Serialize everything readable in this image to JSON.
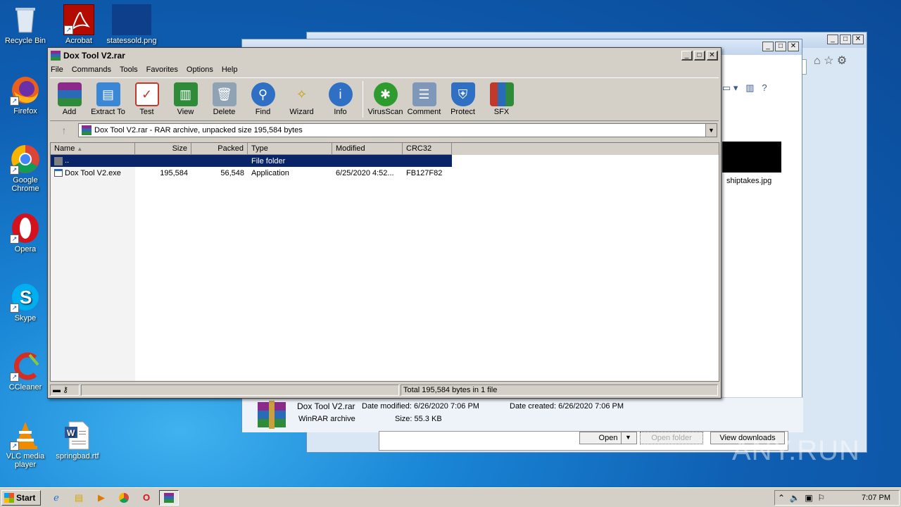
{
  "desktop": {
    "icons": [
      {
        "label": "Recycle Bin"
      },
      {
        "label": "Acrobat"
      },
      {
        "label": "statessold.png"
      },
      {
        "label": "Firefox"
      },
      {
        "label": "Google Chrome"
      },
      {
        "label": "Opera"
      },
      {
        "label": "Skype"
      },
      {
        "label": "CCleaner"
      },
      {
        "label": "VLC media player"
      },
      {
        "label": "springbad.rtf"
      }
    ]
  },
  "bg_window": {
    "thumbnail_label": "shiptakes.jpg",
    "download_item": {
      "name": "Dox Tool V2.rar",
      "modified": "Date modified: 6/26/2020 7:06 PM",
      "created": "Date created: 6/26/2020 7:06 PM",
      "type": "WinRAR archive",
      "size": "Size: 55.3 KB"
    },
    "buttons": {
      "open": "Open",
      "open_folder": "Open folder",
      "view_downloads": "View downloads"
    }
  },
  "winrar": {
    "title": "Dox Tool V2.rar",
    "menu": [
      "File",
      "Commands",
      "Tools",
      "Favorites",
      "Options",
      "Help"
    ],
    "toolbar": [
      {
        "label": "Add",
        "icon": "add-icon",
        "color": "#c0392b"
      },
      {
        "label": "Extract To",
        "icon": "extract-folder-icon",
        "color": "#3a87d6"
      },
      {
        "label": "Test",
        "icon": "test-clipboard-icon",
        "color": "#c0392b"
      },
      {
        "label": "View",
        "icon": "view-book-icon",
        "color": "#2e8b3a"
      },
      {
        "label": "Delete",
        "icon": "trash-icon",
        "color": "#8fa3b5"
      },
      {
        "label": "Find",
        "icon": "magnifier-icon",
        "color": "#2f6fc4"
      },
      {
        "label": "Wizard",
        "icon": "wand-icon",
        "color": "#9aa5b1"
      },
      {
        "label": "Info",
        "icon": "info-icon",
        "color": "#2f6fc4"
      },
      {
        "label": "VirusScan",
        "icon": "virus-scan-icon",
        "color": "#2e9b2e"
      },
      {
        "label": "Comment",
        "icon": "comment-icon",
        "color": "#7f97b8"
      },
      {
        "label": "Protect",
        "icon": "shield-icon",
        "color": "#2f6fc4"
      },
      {
        "label": "SFX",
        "icon": "sfx-icon",
        "color": "#c0392b"
      }
    ],
    "address": "Dox Tool V2.rar - RAR archive, unpacked size 195,584 bytes",
    "columns": [
      "Name",
      "Size",
      "Packed",
      "Type",
      "Modified",
      "CRC32"
    ],
    "rows": [
      {
        "name": "..",
        "size": "",
        "packed": "",
        "type": "File folder",
        "modified": "",
        "crc": ""
      },
      {
        "name": "Dox Tool V2.exe",
        "size": "195,584",
        "packed": "56,548",
        "type": "Application",
        "modified": "6/25/2020 4:52...",
        "crc": "FB127F82"
      }
    ],
    "status": "Total 195,584 bytes in 1 file"
  },
  "taskbar": {
    "start_label": "Start",
    "clock": "7:07 PM"
  },
  "watermark": "ANY.RUN"
}
